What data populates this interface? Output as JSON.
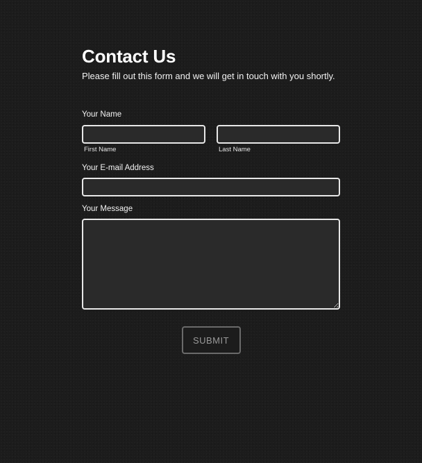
{
  "form": {
    "title": "Contact Us",
    "subtitle": "Please fill out this form and we will get in touch with you shortly.",
    "name_label": "Your Name",
    "first_name": {
      "sublabel": "First Name",
      "value": "",
      "placeholder": ""
    },
    "last_name": {
      "sublabel": "Last Name",
      "value": "",
      "placeholder": ""
    },
    "email_label": "Your E-mail Address",
    "email": {
      "value": "",
      "placeholder": ""
    },
    "message_label": "Your Message",
    "message": {
      "value": "",
      "placeholder": ""
    },
    "submit_label": "SUBMIT"
  },
  "colors": {
    "background": "#1c1c1c",
    "field_background": "#2a2a2a",
    "field_border": "#e8e8e8",
    "submit_border": "#6a6a6a",
    "submit_text": "#9a9a9a",
    "text": "#ffffff"
  }
}
